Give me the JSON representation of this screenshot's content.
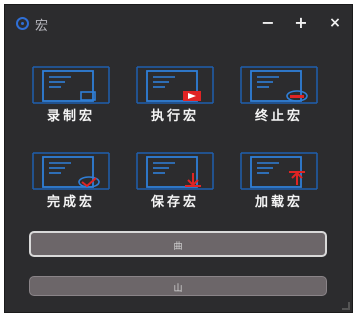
{
  "window": {
    "title": "宏",
    "icon": "app-logo-icon",
    "controls": [
      {
        "name": "minimize",
        "glyph": "−"
      },
      {
        "name": "maximize",
        "glyph": "+"
      },
      {
        "name": "close",
        "glyph": "×"
      }
    ]
  },
  "tiles": [
    {
      "label": "录制宏",
      "icon": "record-macro-icon",
      "mark": "rect"
    },
    {
      "label": "执行宏",
      "icon": "run-macro-icon",
      "mark": "arrow"
    },
    {
      "label": "终止宏",
      "icon": "stop-macro-icon",
      "mark": "minus"
    },
    {
      "label": "完成宏",
      "icon": "finish-macro-icon",
      "mark": "check"
    },
    {
      "label": "保存宏",
      "icon": "save-macro-icon",
      "mark": "save"
    },
    {
      "label": "加载宏",
      "icon": "load-macro-icon",
      "mark": "load"
    }
  ],
  "bars": [
    {
      "label": "曲"
    },
    {
      "label": "山"
    }
  ],
  "colors": {
    "window_bg": "#2c2c2e",
    "tile_outline": "#2f7fd8",
    "accent_red": "#e02424",
    "label": "#f5f5f5"
  }
}
